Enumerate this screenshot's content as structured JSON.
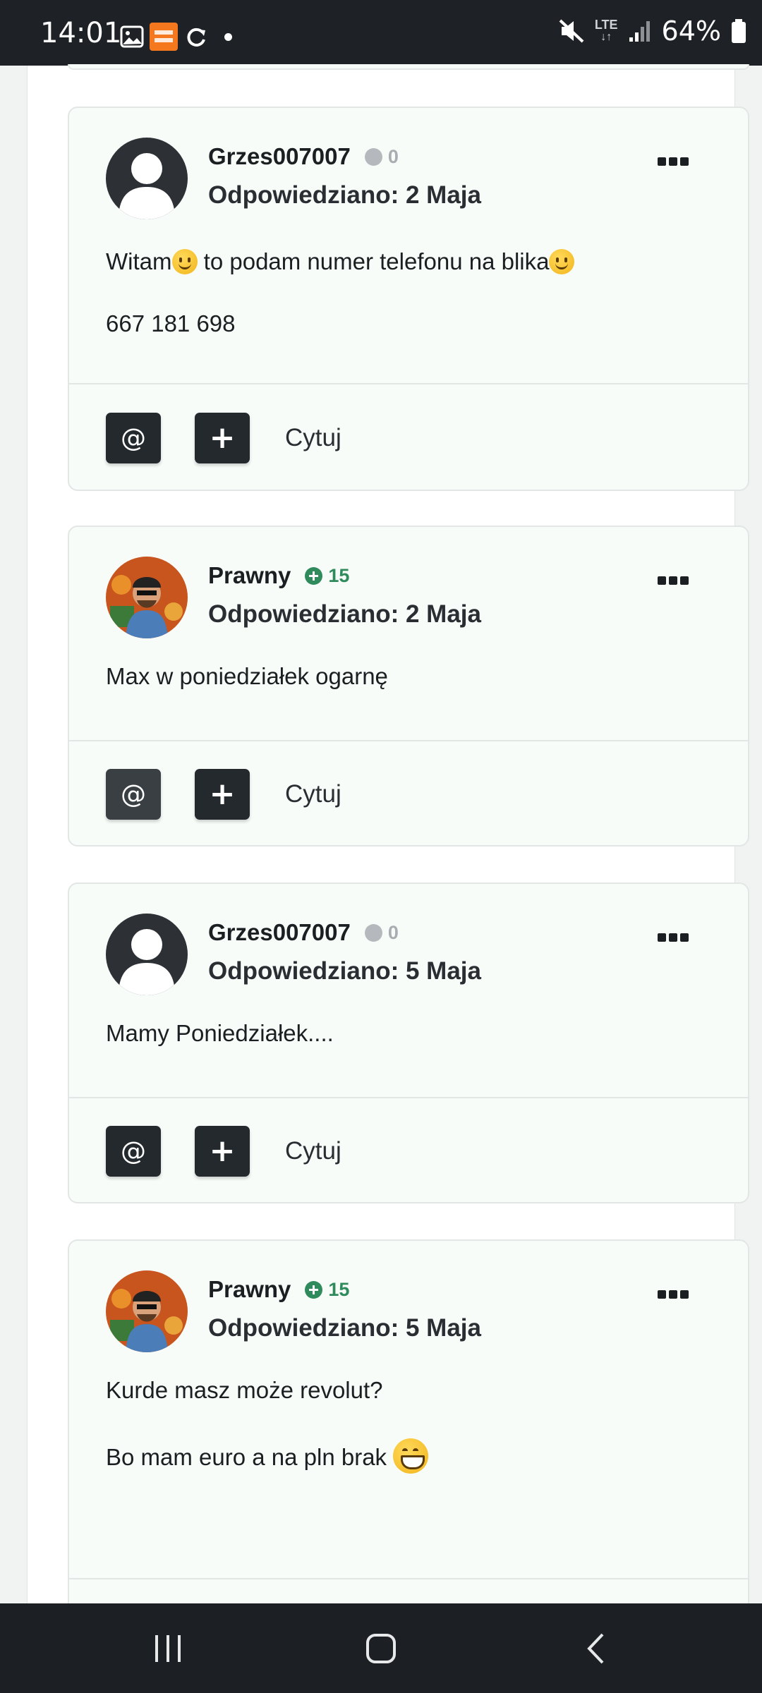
{
  "status_bar": {
    "time": "14:01",
    "battery": "64%",
    "network": "LTE",
    "icons": [
      "image-icon",
      "temu-icon",
      "sync-icon",
      "dot-icon",
      "mute-icon",
      "lte-icon",
      "signal-icon",
      "battery-icon"
    ]
  },
  "posts": [
    {
      "author": "Grzes007007",
      "reputation": "0",
      "reputation_type": "neutral",
      "replied": "Odpowiedziano: 2 Maja",
      "avatar": "default-avatar",
      "lines": [
        {
          "text_a": "Witam",
          "text_b": " to podam numer telefonu na blika",
          "emojis": [
            "slightly-smiling-face",
            "slightly-smiling-face"
          ]
        },
        {
          "text": "667 181 698"
        }
      ],
      "quote_label": "Cytuj"
    },
    {
      "author": "Prawny",
      "reputation": "15",
      "reputation_type": "positive",
      "replied": "Odpowiedziano: 2 Maja",
      "avatar": "photo-avatar",
      "lines": [
        {
          "text": "Max w poniedziałek ogarnę"
        }
      ],
      "quote_label": "Cytuj"
    },
    {
      "author": "Grzes007007",
      "reputation": "0",
      "reputation_type": "neutral",
      "replied": "Odpowiedziano: 5 Maja",
      "avatar": "default-avatar",
      "lines": [
        {
          "text": "Mamy Poniedziałek...."
        }
      ],
      "quote_label": "Cytuj"
    },
    {
      "author": "Prawny",
      "reputation": "15",
      "reputation_type": "positive",
      "replied": "Odpowiedziano: 5 Maja",
      "avatar": "photo-avatar",
      "lines": [
        {
          "text": "Kurde masz może revolut?"
        },
        {
          "text": "Bo mam euro a na pln brak ",
          "emojis": [
            "grinning-face"
          ]
        }
      ],
      "quote_label": null
    }
  ],
  "actions": {
    "mention_label": "@",
    "add_label": "+"
  },
  "colors": {
    "status_bar": "#1e2126",
    "card_bg": "#f8fcf9",
    "button_dark": "#24292d",
    "rep_positive": "#2f8a5c",
    "rep_neutral": "#b5b9bd",
    "nav_bar": "#1c1f24"
  },
  "nav": {
    "icons": [
      "recent-apps-icon",
      "home-icon",
      "back-icon"
    ]
  }
}
